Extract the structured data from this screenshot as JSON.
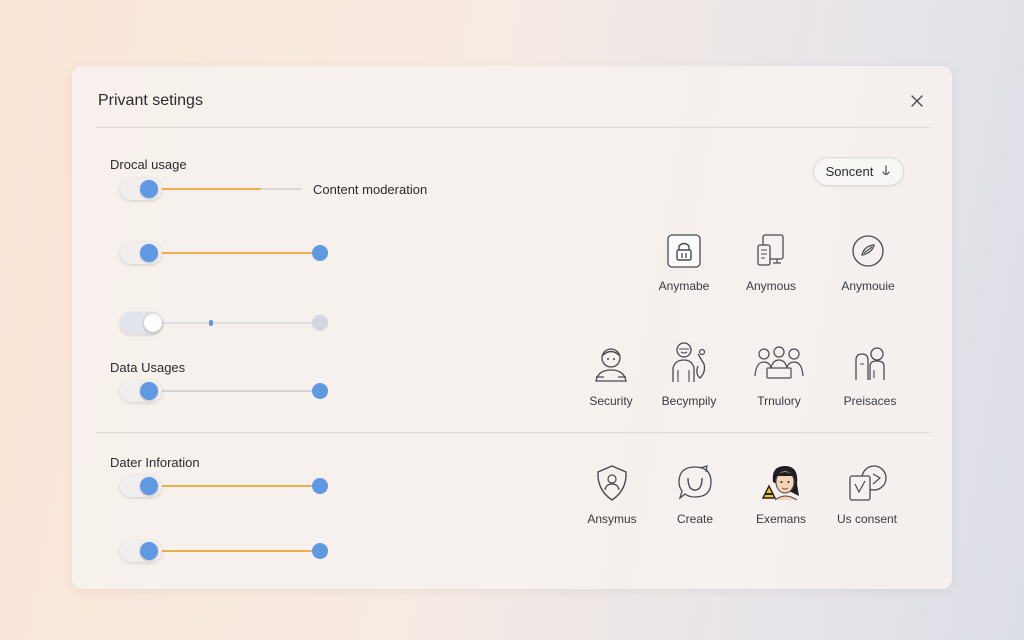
{
  "dialog": {
    "title": "Privant setings",
    "close_icon": "close-icon"
  },
  "sections": {
    "drocal": {
      "label": "Drocal usage",
      "aside": "Content moderation"
    },
    "data": {
      "label": "Data Usages"
    },
    "dater": {
      "label": "Dater Inforation"
    }
  },
  "sliders": [
    {
      "level": 0.73,
      "enabled": true,
      "has_end_knob": false
    },
    {
      "level": 1.0,
      "enabled": true,
      "has_end_knob": true
    },
    {
      "level": 0.3,
      "enabled": false,
      "has_end_knob": true
    },
    {
      "level": 1.0,
      "enabled": true,
      "has_end_knob": true
    },
    {
      "level": 1.0,
      "enabled": true,
      "has_end_knob": true
    },
    {
      "level": 1.0,
      "enabled": true,
      "has_end_knob": true
    }
  ],
  "consent_button": {
    "label": "Soncent",
    "icon": "microphone-icon"
  },
  "tiles": [
    {
      "label": "Anymabe",
      "icon": "lock-icon"
    },
    {
      "label": "Anymous",
      "icon": "devices-icon"
    },
    {
      "label": "Anymouie",
      "icon": "compass-icon"
    },
    {
      "label": "Security",
      "icon": "person-icon"
    },
    {
      "label": "Becympily",
      "icon": "worker-icon"
    },
    {
      "label": "Trnulory",
      "icon": "group-icon"
    },
    {
      "label": "Preisaces",
      "icon": "people-icon"
    },
    {
      "label": "Ansymus",
      "icon": "shield-icon"
    },
    {
      "label": "Create",
      "icon": "chat-icon"
    },
    {
      "label": "Exemans",
      "icon": "avatar-icon"
    },
    {
      "label": "Us consent",
      "icon": "document-icon"
    }
  ],
  "colors": {
    "accent": "#5f98e3",
    "track_fill": "#ecb14e",
    "icon_stroke": "#4a4a52"
  }
}
